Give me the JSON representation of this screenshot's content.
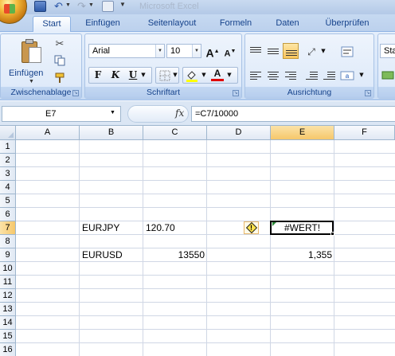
{
  "title_bar": {
    "document_title": "Microsoft Excel"
  },
  "tabs": [
    {
      "label": "Start",
      "active": true
    },
    {
      "label": "Einfügen",
      "active": false
    },
    {
      "label": "Seitenlayout",
      "active": false
    },
    {
      "label": "Formeln",
      "active": false
    },
    {
      "label": "Daten",
      "active": false
    },
    {
      "label": "Überprüfen",
      "active": false
    }
  ],
  "ribbon": {
    "clipboard": {
      "paste_label": "Einfügen",
      "group_label": "Zwischenablage"
    },
    "font": {
      "font_name": "Arial",
      "font_size": "10",
      "bold": "F",
      "italic": "K",
      "underline": "U",
      "group_label": "Schriftart"
    },
    "alignment": {
      "group_label": "Ausrichtung"
    },
    "styles": {
      "partial_label": "Sta"
    }
  },
  "formula_bar": {
    "name_box": "E7",
    "fx": "fx",
    "formula": "=C7/10000"
  },
  "grid": {
    "columns": [
      "A",
      "B",
      "C",
      "D",
      "E",
      "F"
    ],
    "selected_column": "E",
    "rows": [
      "1",
      "2",
      "3",
      "4",
      "5",
      "6",
      "7",
      "8",
      "9",
      "10",
      "11",
      "12",
      "13",
      "14",
      "15",
      "16"
    ],
    "selected_row": "7",
    "cells": {
      "B7": "EURJPY",
      "C7": "120.70",
      "E7": "#WERT!",
      "B9": "EURUSD",
      "C9": "13550",
      "E9": "1,355"
    }
  },
  "colors": {
    "accent": "#15428b",
    "selection": "#f6c76a",
    "grid_line": "#d0d7e5",
    "error_triangle": "#2e8a3a"
  }
}
